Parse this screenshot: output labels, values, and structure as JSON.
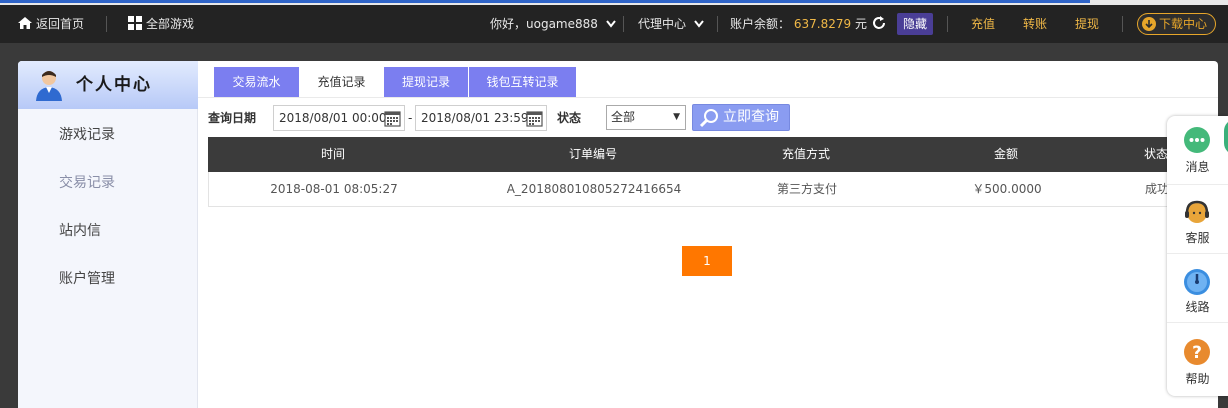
{
  "header": {
    "home_label": "返回首页",
    "all_games_label": "全部游戏",
    "greeting": "你好，uogame888",
    "agent_center": "代理中心",
    "balance_label": "账户余额：",
    "balance_value": "637.8279",
    "balance_unit": "元",
    "hide_label": "隐藏",
    "recharge_label": "充值",
    "transfer_label": "转账",
    "withdraw_label": "提现",
    "download_label": "下载中心"
  },
  "sidebar": {
    "title": "个人中心",
    "items": [
      {
        "label": "游戏记录",
        "active": false
      },
      {
        "label": "交易记录",
        "active": true
      },
      {
        "label": "站内信",
        "active": false
      },
      {
        "label": "账户管理",
        "active": false
      }
    ]
  },
  "tabs": [
    {
      "label": "交易流水",
      "active": false
    },
    {
      "label": "充值记录",
      "active": true
    },
    {
      "label": "提现记录",
      "active": false
    },
    {
      "label": "钱包互转记录",
      "active": false
    }
  ],
  "filter": {
    "date_label": "查询日期",
    "start_date": "2018/08/01 00:00",
    "separator": "-",
    "end_date": "2018/08/01 23:59",
    "status_label": "状态",
    "status_value": "全部",
    "query_label": "立即查询"
  },
  "table": {
    "headers": [
      "时间",
      "订单编号",
      "充值方式",
      "金额",
      "状态"
    ],
    "rows": [
      [
        "2018-08-01 08:05:27",
        "A_20180801080527241665 4",
        "第三方支付",
        "￥500.0000",
        "成功"
      ]
    ]
  },
  "pagination": {
    "current_page": "1"
  },
  "floatbar": {
    "items": [
      {
        "label": "消息",
        "icon": "message-icon"
      },
      {
        "label": "客服",
        "icon": "customer-service-icon"
      },
      {
        "label": "线路",
        "icon": "route-icon"
      },
      {
        "label": "帮助",
        "icon": "help-icon"
      }
    ]
  },
  "colors": {
    "header_bg": "#232323",
    "accent_gold": "#f0b847",
    "tab_purple": "#7b7ef0",
    "page_orange": "#ff7700",
    "table_head_bg": "#3b3b3b"
  }
}
